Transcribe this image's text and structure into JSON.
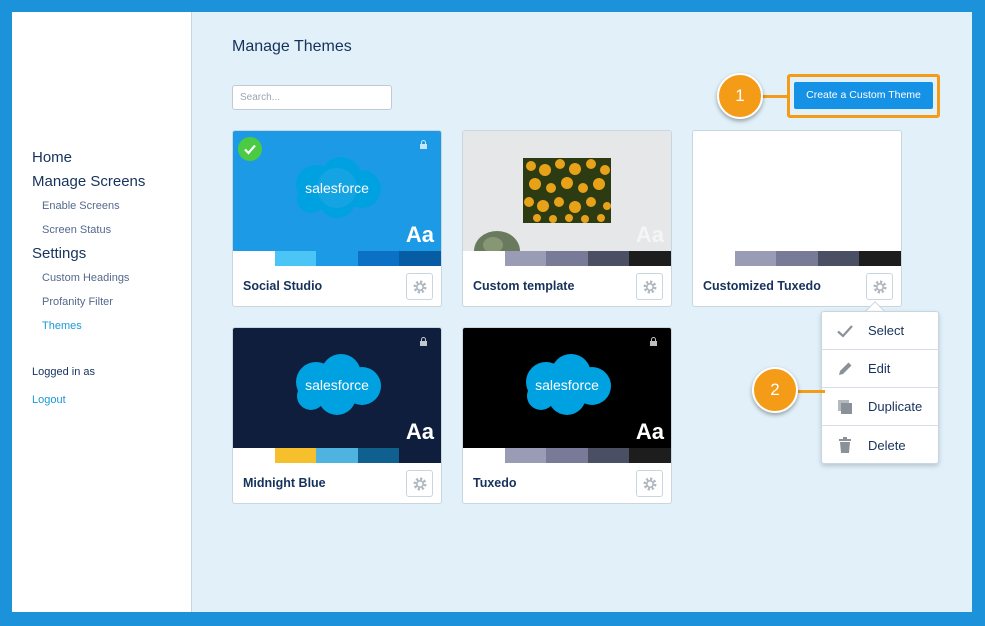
{
  "sidebar": {
    "items": [
      {
        "label": "Home"
      },
      {
        "label": "Manage Screens"
      },
      {
        "label": "Enable Screens"
      },
      {
        "label": "Screen Status"
      },
      {
        "label": "Settings"
      },
      {
        "label": "Custom Headings"
      },
      {
        "label": "Profanity Filter"
      },
      {
        "label": "Themes"
      }
    ],
    "logged_in_label": "Logged in as",
    "logout_label": "Logout",
    "active_color": "#1a9ad9"
  },
  "main": {
    "title": "Manage Themes",
    "search_placeholder": "Search...",
    "create_button": "Create a Custom Theme"
  },
  "callouts": {
    "one": "1",
    "two": "2",
    "color": "#f49b18"
  },
  "themes": [
    {
      "name": "Social Studio",
      "logo": "salesforce",
      "aa": "Aa",
      "selected": true,
      "swatches": [
        "#ffffff",
        "#4bc5f5",
        "#1d9ae6",
        "#0c70c4",
        "#075da3"
      ]
    },
    {
      "name": "Custom template",
      "aa": "Aa",
      "swatches": [
        "#ffffff",
        "#9a9cb5",
        "#787a98",
        "#4a4f63",
        "#1d1d1d"
      ]
    },
    {
      "name": "Customized Tuxedo",
      "swatches": [
        "#ffffff",
        "#9a9cb5",
        "#787a98",
        "#4a4f63",
        "#1d1d1d"
      ]
    },
    {
      "name": "Midnight Blue",
      "logo": "salesforce",
      "aa": "Aa",
      "swatches": [
        "#ffffff",
        "#f6c02c",
        "#4fb3e0",
        "#0f5f8f",
        "#0e1e3c"
      ]
    },
    {
      "name": "Tuxedo",
      "logo": "salesforce",
      "aa": "Aa",
      "swatches": [
        "#ffffff",
        "#9a9cb5",
        "#787a98",
        "#4a4f63",
        "#1d1d1d"
      ]
    }
  ],
  "context_menu": {
    "items": [
      {
        "label": "Select",
        "icon": "check-icon"
      },
      {
        "label": "Edit",
        "icon": "pencil-icon"
      },
      {
        "label": "Duplicate",
        "icon": "duplicate-icon"
      },
      {
        "label": "Delete",
        "icon": "trash-icon"
      }
    ]
  }
}
